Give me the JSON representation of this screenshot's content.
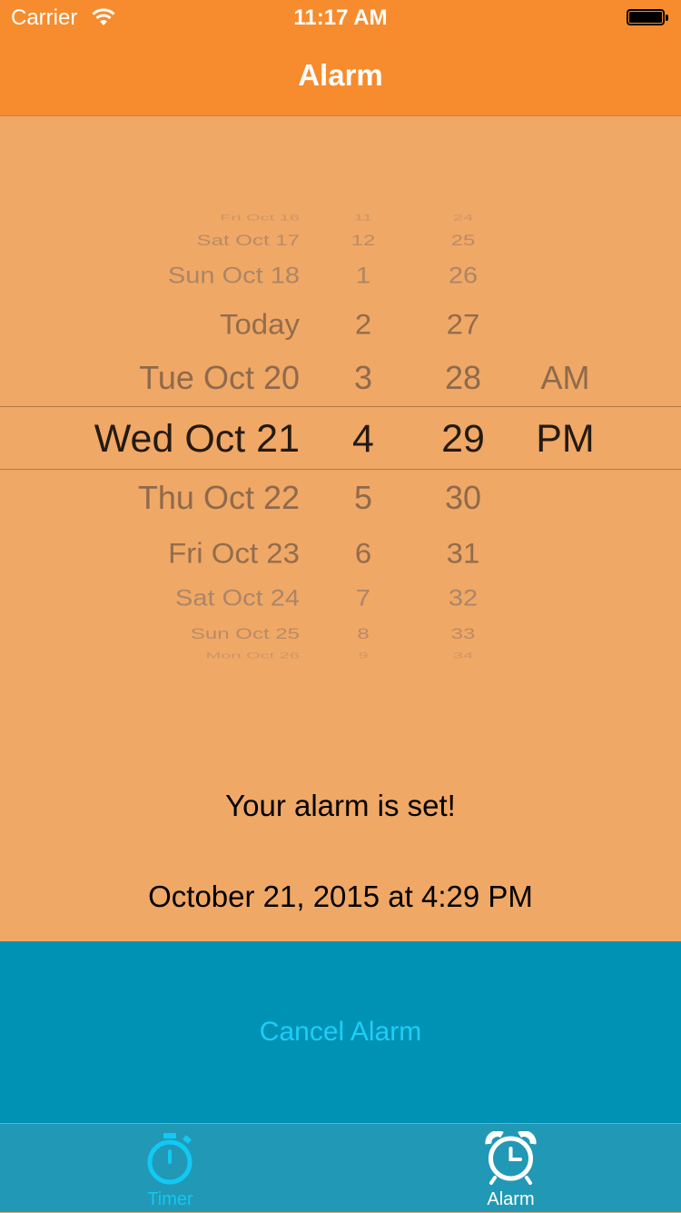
{
  "status_bar": {
    "carrier": "Carrier",
    "time": "11:17 AM"
  },
  "nav": {
    "title": "Alarm"
  },
  "picker": {
    "dates": [
      "Fri Oct 16",
      "Sat Oct 17",
      "Sun Oct 18",
      "Today",
      "Tue Oct 20",
      "Wed Oct 21",
      "Thu Oct 22",
      "Fri Oct 23",
      "Sat Oct 24",
      "Sun Oct 25",
      "Mon Oct 26"
    ],
    "hours": [
      "11",
      "12",
      "1",
      "2",
      "3",
      "4",
      "5",
      "6",
      "7",
      "8",
      "9"
    ],
    "minutes": [
      "24",
      "25",
      "26",
      "27",
      "28",
      "29",
      "30",
      "31",
      "32",
      "33",
      "34"
    ],
    "ampm": [
      "AM",
      "PM"
    ],
    "selected": {
      "date": "Wed Oct 21",
      "hour": "4",
      "minute": "29",
      "ampm": "PM"
    }
  },
  "message": {
    "status": "Your alarm is set!",
    "datetime": "October 21, 2015 at 4:29 PM"
  },
  "cancel_button": {
    "label": "Cancel Alarm"
  },
  "tabs": [
    {
      "label": "Timer",
      "icon": "stopwatch-icon",
      "selected": false
    },
    {
      "label": "Alarm",
      "icon": "alarm-clock-icon",
      "selected": true
    }
  ],
  "colors": {
    "nav_bar": "#f68c2e",
    "background": "#f0a866",
    "cancel_area": "#0092b5",
    "cancel_text": "#1ecdf8",
    "tab_bar": "#2198b5",
    "tab_inactive": "#12c8f4",
    "tab_active": "#ffffff"
  }
}
